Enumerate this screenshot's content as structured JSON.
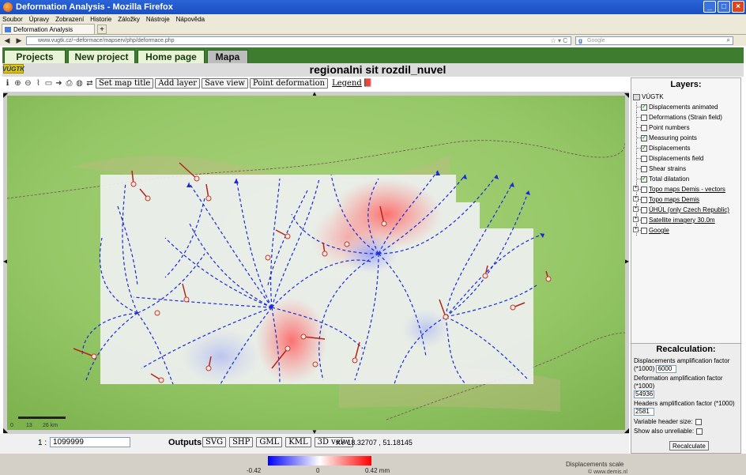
{
  "browser": {
    "window_title": "Deformation Analysis - Mozilla Firefox",
    "menu": [
      "Soubor",
      "Úpravy",
      "Zobrazení",
      "Historie",
      "Záložky",
      "Nástroje",
      "Nápověda"
    ],
    "tab_title": "Deformation Analysis",
    "new_tab_label": "+",
    "url": "www.vugtk.cz/~deformace/mapserv/php/deformace.php",
    "search_placeholder": "Google"
  },
  "app": {
    "tabs": [
      {
        "label": "Projects"
      },
      {
        "label": "New project"
      },
      {
        "label": "Home page"
      },
      {
        "label": "Mapa",
        "active": true
      }
    ],
    "logo_text": "VÚGTK",
    "page_title": "regionalni sit rozdil_nuvel"
  },
  "toolbar": {
    "set_map_title": "Set map title",
    "add_layer": "Add layer",
    "save_view": "Save view",
    "point_deformation": "Point deformation",
    "legend": "Legend"
  },
  "map": {
    "colorbar_min": "-0.42",
    "colorbar_mid": "0",
    "colorbar_max": "0.42 mm",
    "scale_labels": [
      "0",
      "13",
      "26 km"
    ],
    "displacements_scale": "Displacements scale",
    "credit": "© www.demis.nl"
  },
  "bottom": {
    "scale_prefix": "1 :",
    "scale_value": "1099999",
    "outputs_label": "Outputs:",
    "output_buttons": [
      "SVG",
      "SHP",
      "GML",
      "KML",
      "3D veiw"
    ],
    "xy": "XY 18.32707 , 51.18145"
  },
  "layers": {
    "title": "Layers:",
    "root": "VÚGTK",
    "items": [
      {
        "label": "Displacements animated",
        "checked": true,
        "ext": false
      },
      {
        "label": "Deformations (Strain field)",
        "checked": false,
        "ext": false
      },
      {
        "label": "Point numbers",
        "checked": false,
        "ext": false
      },
      {
        "label": "Measuring points",
        "checked": true,
        "ext": false
      },
      {
        "label": "Displacements",
        "checked": true,
        "ext": false
      },
      {
        "label": "Displacements field",
        "checked": false,
        "ext": false
      },
      {
        "label": "Shear strains",
        "checked": false,
        "ext": false
      },
      {
        "label": "Total dilatation",
        "checked": true,
        "ext": false
      },
      {
        "label": "Topo maps Demis - vectors",
        "checked": false,
        "ext": true
      },
      {
        "label": "Topo maps Demis",
        "checked": false,
        "ext": true
      },
      {
        "label": "ÚHÚL (only Czech Republic)",
        "checked": false,
        "ext": true
      },
      {
        "label": "Satellite imagery 30.0m",
        "checked": false,
        "ext": true
      },
      {
        "label": "Google",
        "checked": false,
        "ext": true
      }
    ]
  },
  "recalculation": {
    "title": "Recalculation:",
    "disp_factor_label": "Displacements amplification factor (*1000)",
    "disp_factor_value": "6000",
    "def_factor_label": "Deformation amplification factor (*1000)",
    "def_factor_value": "54936",
    "headers_factor_label": "Headers amplification factor (*1000)",
    "headers_factor_value": "2581",
    "variable_header_label": "Variable header size:",
    "show_unreliable_label": "Show also unreliable:",
    "recalculate_button": "Recalculate"
  }
}
